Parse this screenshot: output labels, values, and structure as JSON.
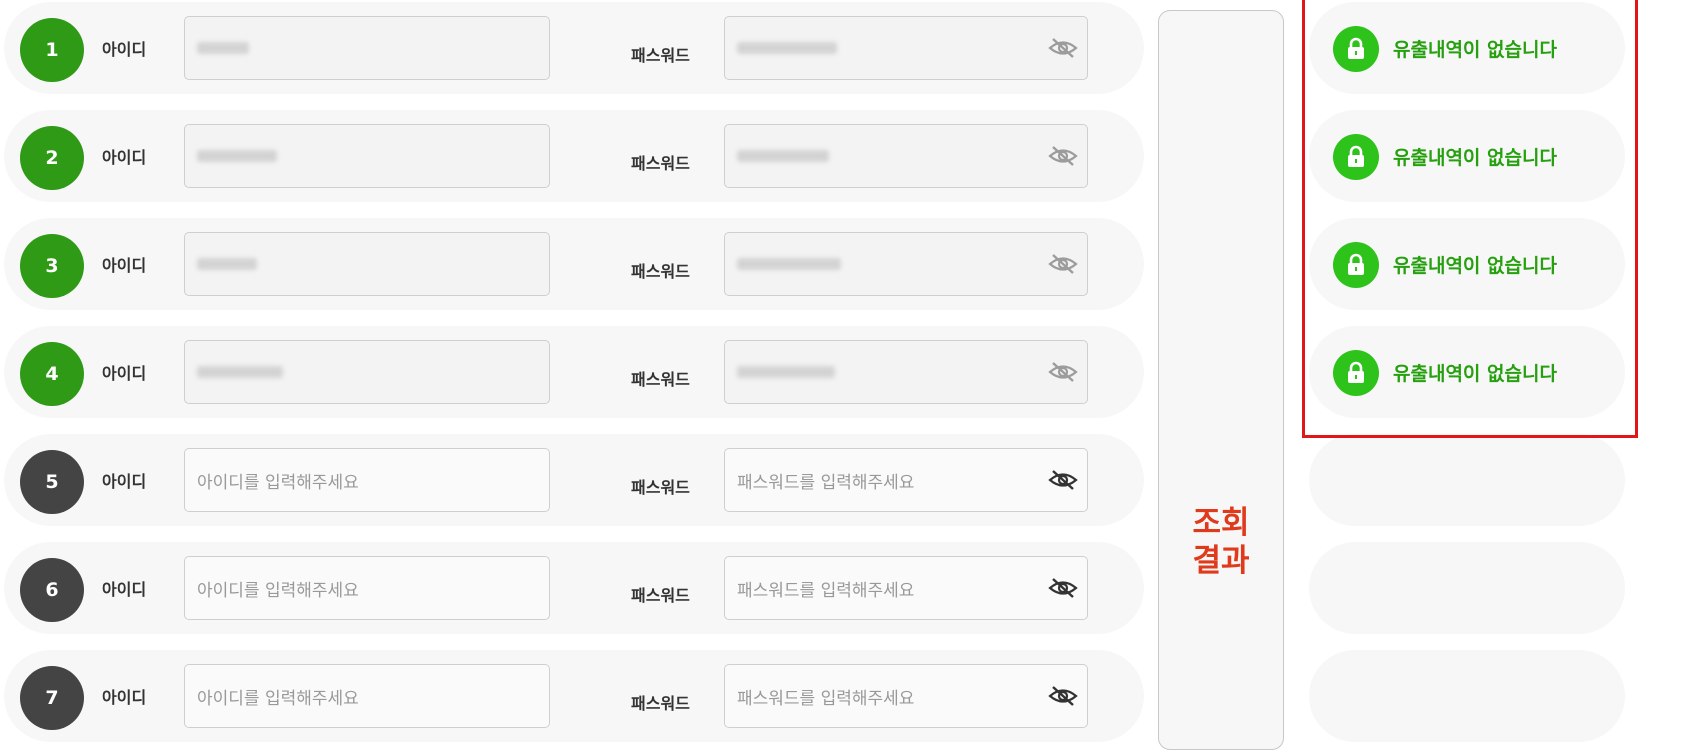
{
  "labels": {
    "id": "아이디",
    "pw": "패스워드"
  },
  "placeholders": {
    "id": "아이디를 입력해주세요",
    "pw": "패스워드를 입력해주세요"
  },
  "search_button": {
    "label_line1": "조회",
    "label_line2": "결과"
  },
  "result_text": "유출내역이 없습니다",
  "rows": [
    {
      "number": "1",
      "state": "filled"
    },
    {
      "number": "2",
      "state": "filled"
    },
    {
      "number": "3",
      "state": "filled"
    },
    {
      "number": "4",
      "state": "filled"
    },
    {
      "number": "5",
      "state": "empty"
    },
    {
      "number": "6",
      "state": "empty"
    },
    {
      "number": "7",
      "state": "empty"
    }
  ],
  "results": [
    {
      "text": "유출내역이 없습니다"
    },
    {
      "text": "유출내역이 없습니다"
    },
    {
      "text": "유출내역이 없습니다"
    },
    {
      "text": "유출내역이 없습니다"
    },
    {
      "text": ""
    },
    {
      "text": ""
    },
    {
      "text": ""
    }
  ],
  "colors": {
    "number_done": "#2e9a16",
    "number_empty": "#444444",
    "result_green": "#26a00f",
    "search_label_red": "#e03a1c",
    "highlight_red": "#e0161b"
  },
  "icons": {
    "password_toggle": "eye-slash-icon",
    "result": "lock-icon"
  }
}
